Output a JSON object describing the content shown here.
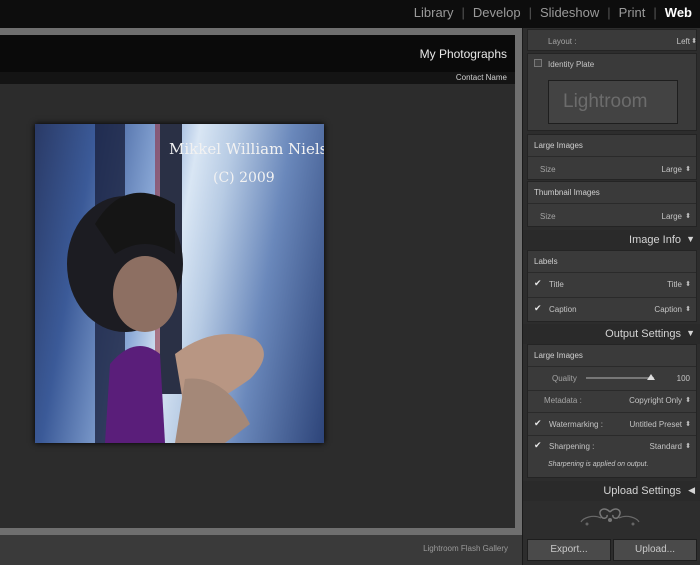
{
  "modules": {
    "items": [
      "Library",
      "Develop",
      "Slideshow",
      "Print",
      "Web"
    ],
    "active": "Web",
    "separator": "|"
  },
  "preview": {
    "site_title": "My Photographs",
    "contact_name": "Contact Name",
    "gallery_name": "Lightroom Flash Gallery",
    "photo": {
      "watermark_line1": "Mikkel William Nielsen",
      "watermark_line2": "(C) 2009"
    }
  },
  "panel": {
    "layout": {
      "label": "Layout :",
      "value": "Left"
    },
    "identity_plate": {
      "label": "Identity Plate",
      "checked": false,
      "plate_text": "Lightroom"
    },
    "large_images": {
      "header": "Large Images",
      "size_label": "Size",
      "size_value": "Large"
    },
    "thumbnail_images": {
      "header": "Thumbnail Images",
      "size_label": "Size",
      "size_value": "Large"
    },
    "image_info": {
      "title": "Image Info",
      "labels_header": "Labels",
      "title_row": {
        "label": "Title",
        "value": "Title",
        "checked": true
      },
      "caption_row": {
        "label": "Caption",
        "value": "Caption",
        "checked": true
      }
    },
    "output_settings": {
      "title": "Output Settings",
      "large_images_header": "Large Images",
      "quality_label": "Quality",
      "quality_value": "100",
      "quality_fraction": 0.95,
      "metadata_label": "Metadata :",
      "metadata_value": "Copyright Only",
      "watermarking_label": "Watermarking :",
      "watermarking_value": "Untitled Preset",
      "watermarking_checked": true,
      "sharpening_label": "Sharpening :",
      "sharpening_value": "Standard",
      "sharpening_checked": true,
      "sharpening_note": "Sharpening is applied on output."
    },
    "upload_settings": {
      "title": "Upload Settings"
    },
    "buttons": {
      "export": "Export...",
      "upload": "Upload..."
    }
  }
}
